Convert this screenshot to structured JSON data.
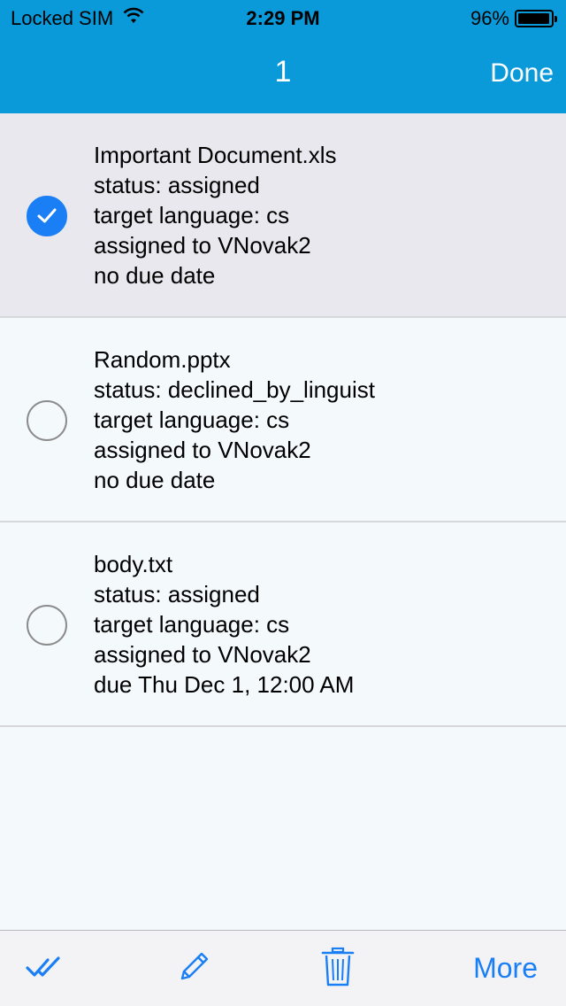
{
  "status_bar": {
    "carrier": "Locked SIM",
    "time": "2:29 PM",
    "battery": "96%",
    "battery_level": 0.96
  },
  "nav": {
    "title": "1",
    "done_label": "Done"
  },
  "items": [
    {
      "selected": true,
      "name": "Important Document.xls",
      "status": "status: assigned",
      "target": "target language: cs",
      "assigned": "assigned to VNovak2",
      "due": "no due date"
    },
    {
      "selected": false,
      "name": "Random.pptx",
      "status": "status: declined_by_linguist",
      "target": "target language: cs",
      "assigned": "assigned to VNovak2",
      "due": "no due date"
    },
    {
      "selected": false,
      "name": "body.txt",
      "status": "status: assigned",
      "target": "target language: cs",
      "assigned": "assigned to VNovak2",
      "due": "due Thu Dec 1, 12:00 AM"
    }
  ],
  "toolbar": {
    "icons": [
      "double-check-icon",
      "pencil-icon",
      "trash-icon"
    ],
    "more_label": "More"
  },
  "colors": {
    "nav_background": "#0a9ad9",
    "accent": "#1a7ff5",
    "selected_row": "#e9e8ee"
  }
}
